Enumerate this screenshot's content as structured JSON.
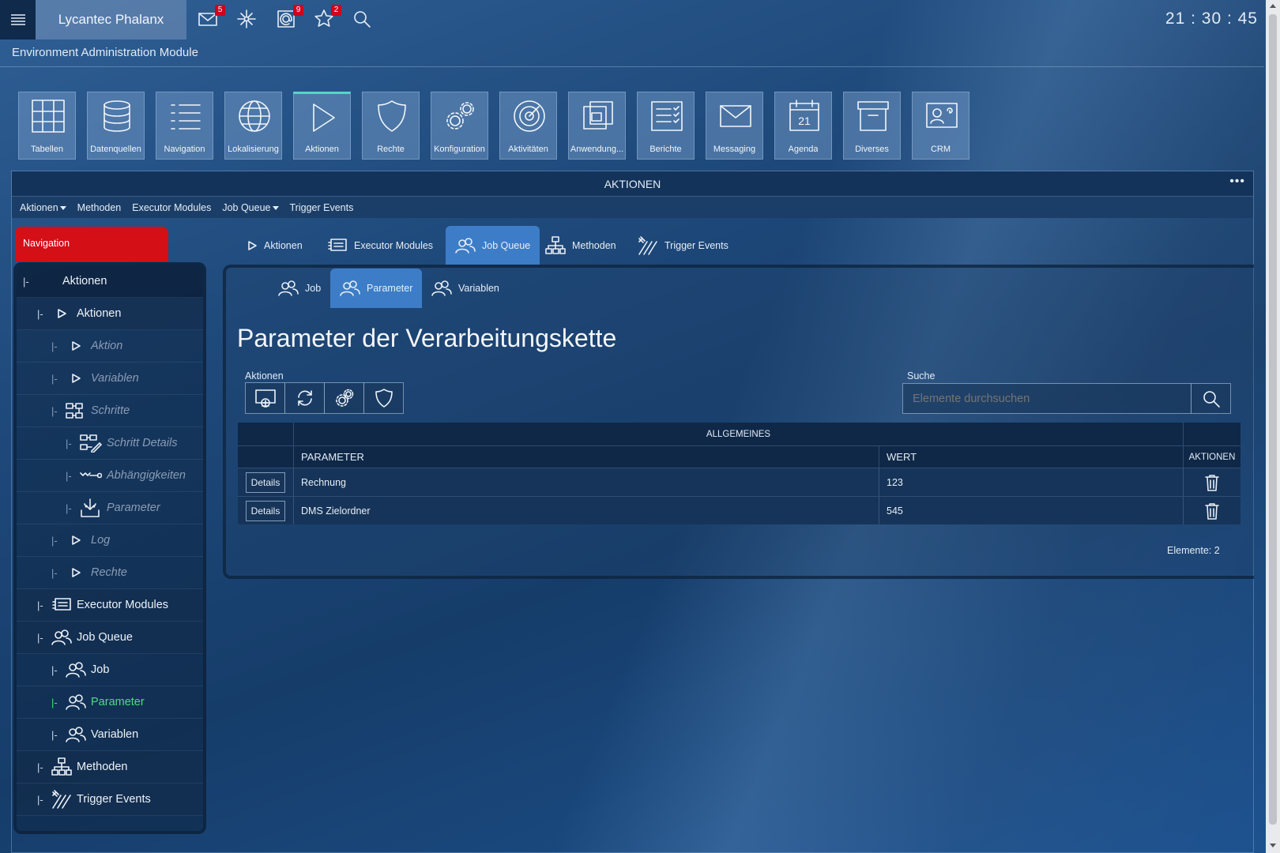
{
  "app": {
    "title": "Lycantec Phalanx",
    "module_title": "Environment Administration Module",
    "clock": "21 : 30 : 45"
  },
  "toolbar": {
    "mail_badge": "5",
    "contacts_badge": "9",
    "favorites_badge": "2"
  },
  "tiles": [
    {
      "label": "Tabellen",
      "icon": "table-icon"
    },
    {
      "label": "Datenquellen",
      "icon": "database-icon"
    },
    {
      "label": "Navigation",
      "icon": "list-icon"
    },
    {
      "label": "Lokalisierung",
      "icon": "globe-icon"
    },
    {
      "label": "Aktionen",
      "icon": "play-icon"
    },
    {
      "label": "Rechte",
      "icon": "shield-icon"
    },
    {
      "label": "Konfiguration",
      "icon": "gears-icon"
    },
    {
      "label": "Aktivitäten",
      "icon": "target-icon"
    },
    {
      "label": "Anwendung...",
      "icon": "windows-icon"
    },
    {
      "label": "Berichte",
      "icon": "report-icon"
    },
    {
      "label": "Messaging",
      "icon": "mail-icon"
    },
    {
      "label": "Agenda",
      "icon": "calendar-icon",
      "day": "21"
    },
    {
      "label": "Diverses",
      "icon": "archive-icon"
    },
    {
      "label": "CRM",
      "icon": "contact-card-icon"
    }
  ],
  "panel": {
    "title": "AKTIONEN",
    "dots": "•••",
    "menu": [
      "Aktionen",
      "Methoden",
      "Executor Modules",
      "Job Queue",
      "Trigger Events"
    ]
  },
  "nav": {
    "badge": "Navigation",
    "prefix": "|-",
    "items": [
      {
        "label": "Aktionen"
      },
      {
        "label": "Aktionen"
      },
      {
        "label": "Aktion"
      },
      {
        "label": "Variablen"
      },
      {
        "label": "Schritte"
      },
      {
        "label": "Schritt Details"
      },
      {
        "label": "Abhängigkeiten"
      },
      {
        "label": "Parameter"
      },
      {
        "label": "Log"
      },
      {
        "label": "Rechte"
      },
      {
        "label": "Executor Modules"
      },
      {
        "label": "Job Queue"
      },
      {
        "label": "Job"
      },
      {
        "label": "Parameter"
      },
      {
        "label": "Variablen"
      },
      {
        "label": "Methoden"
      },
      {
        "label": "Trigger Events"
      }
    ]
  },
  "tabs": [
    "Aktionen",
    "Executor Modules",
    "Job Queue",
    "Methoden",
    "Trigger Events"
  ],
  "subtabs": [
    "Job",
    "Parameter",
    "Variablen"
  ],
  "page": {
    "title": "Parameter der Verarbeitungskette",
    "actions_label": "Aktionen",
    "search_label": "Suche",
    "search_placeholder": "Elemente durchsuchen"
  },
  "table": {
    "group_header": "ALLGEMEINES",
    "columns": [
      "PARAMETER",
      "WERT",
      "AKTIONEN"
    ],
    "details_label": "Details",
    "rows": [
      {
        "parameter": "Rechnung",
        "wert": "123"
      },
      {
        "parameter": "DMS Zielordner",
        "wert": "545"
      }
    ],
    "count": "Elemente: 2"
  },
  "colors": {
    "accent": "#3d7dc7",
    "nav_badge": "#d40f16",
    "selected": "#49e07a",
    "tile_active": "#58d3c8"
  }
}
